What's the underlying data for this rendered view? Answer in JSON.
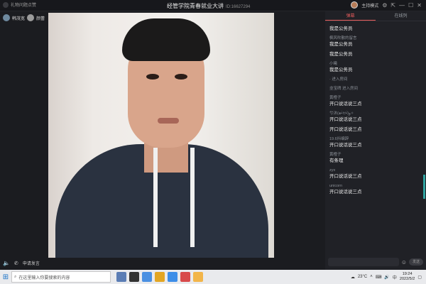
{
  "window": {
    "left_label": "礼物问题点赞",
    "title": "经管学院青春就业大讲",
    "room_id": "ID:16627294",
    "mode": "主持模式"
  },
  "hosts": [
    {
      "name": "韩茂宽"
    },
    {
      "name": "颜蕾"
    }
  ],
  "bottom": {
    "apply_label": "申请发言"
  },
  "panel": {
    "tabs": [
      "弹幕",
      "在线列"
    ],
    "active_tab": 0,
    "messages": [
      {
        "name": "",
        "text": "我是公务员"
      },
      {
        "name": "枫风吹散的留言",
        "text": "我是公务员"
      },
      {
        "name": "",
        "text": "我是公务员"
      },
      {
        "name": "小曦",
        "text": "我是公务员"
      },
      {
        "sys": "· 进入房间"
      },
      {
        "sys": "韭宝碑 进入房间"
      },
      {
        "name": "黄橙子",
        "text": "开口说话说三点"
      },
      {
        "name": "兮沐(๑•̀ㅂ•́)و✧",
        "text": "开口说话说三点"
      },
      {
        "name": "",
        "text": "开口说话说三点"
      },
      {
        "name": "19.6抖编辞",
        "text": "开口说话说三点"
      },
      {
        "name": "黄橙子",
        "text": "有条理"
      },
      {
        "name": "zyx",
        "text": "开口说话说三点"
      },
      {
        "name": "unicorn",
        "text": "开口说话说三点"
      }
    ],
    "send_label": "发送"
  },
  "taskbar": {
    "search_placeholder": "在这里输入你要搜索的内容",
    "weather": "23°C",
    "ime": "中",
    "time": "19:24",
    "date": "2022/5/2"
  },
  "colors": {
    "accent": "#e85d5d",
    "bg": "#1b1c20",
    "panel": "#202126"
  }
}
